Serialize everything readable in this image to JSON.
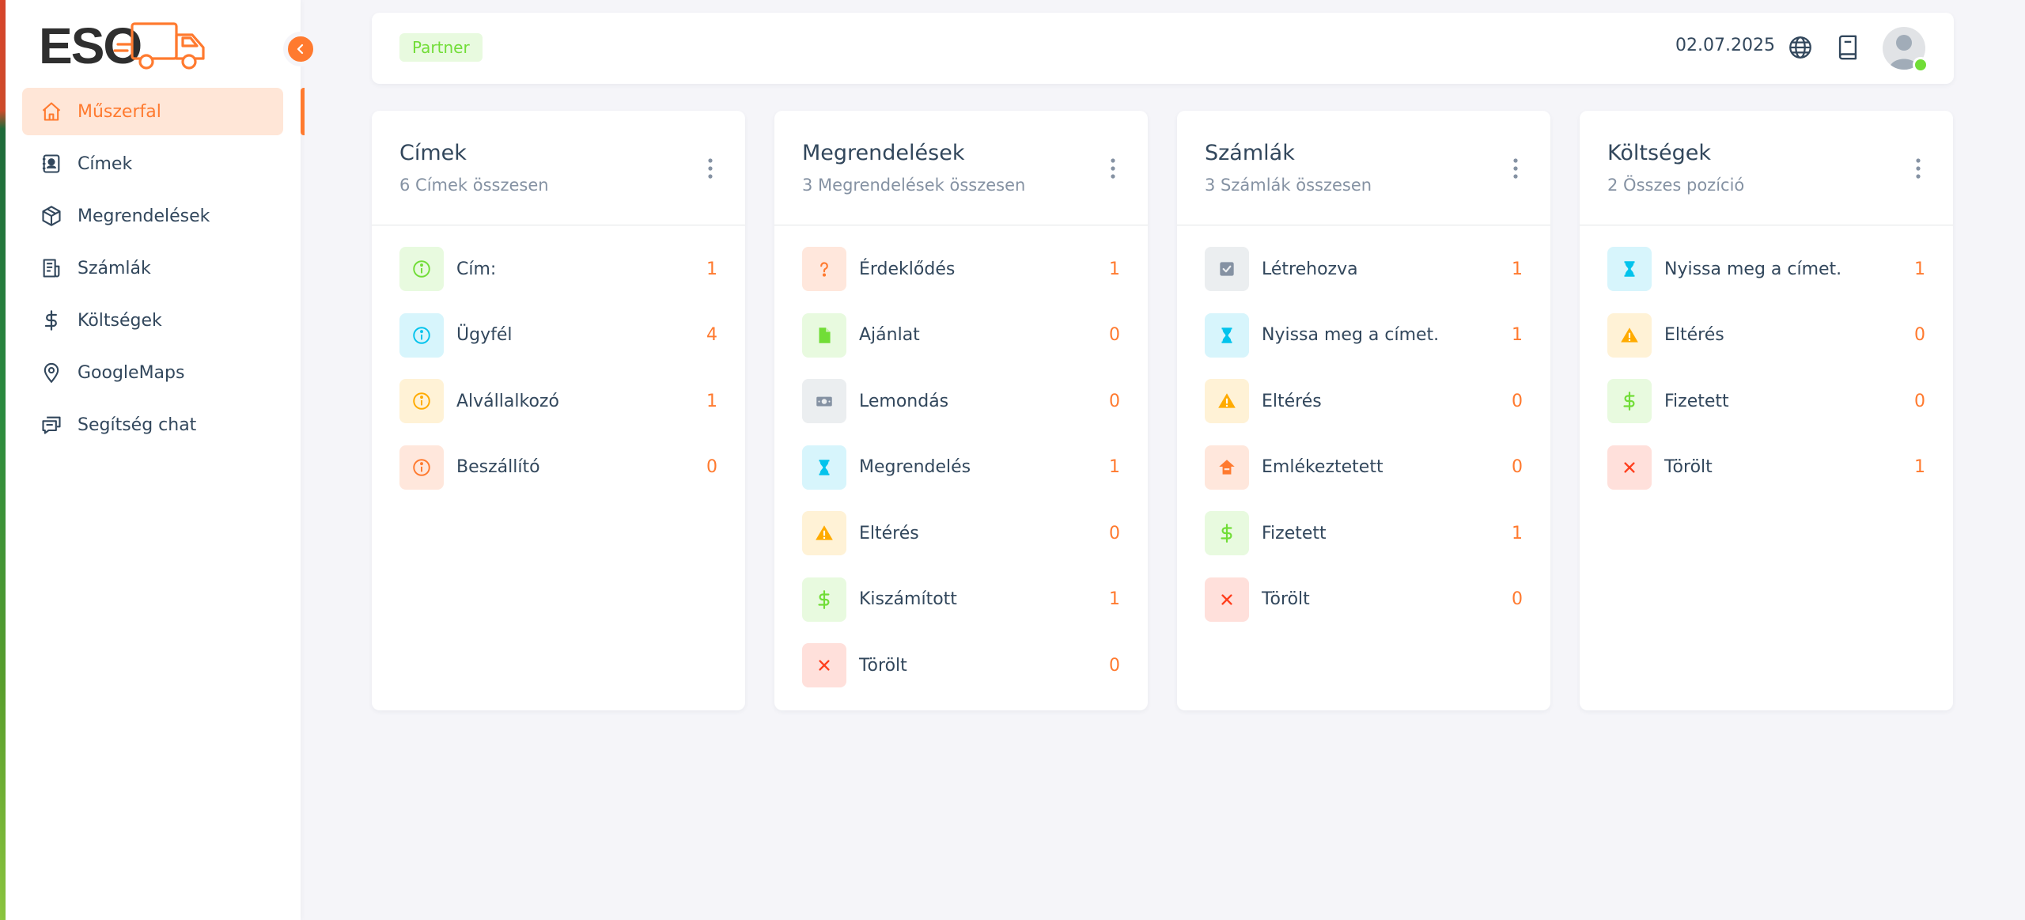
{
  "brand": {
    "logo_text": "ESO"
  },
  "sidebar": {
    "items": [
      {
        "label": "Műszerfal",
        "icon": "home-icon"
      },
      {
        "label": "Címek",
        "icon": "contact-book-icon"
      },
      {
        "label": "Megrendelések",
        "icon": "package-icon"
      },
      {
        "label": "Számlák",
        "icon": "invoice-icon"
      },
      {
        "label": "Költségek",
        "icon": "dollar-icon"
      },
      {
        "label": "GoogleMaps",
        "icon": "map-pin-icon"
      },
      {
        "label": "Segítség chat",
        "icon": "chat-icon"
      }
    ]
  },
  "header": {
    "badge": "Partner",
    "date": "02.07.2025",
    "icons": [
      "globe-icon",
      "book-icon",
      "avatar"
    ]
  },
  "colors": {
    "accent": "#ff7a2f",
    "success": "#71dd37",
    "info": "#03c3ec",
    "warning": "#ffab00",
    "danger": "#ff3e1d",
    "secondary": "#8592a3"
  },
  "cards": [
    {
      "title": "Címek",
      "subtitle": "6 Címek összesen",
      "rows": [
        {
          "label": "Cím:",
          "count": "1",
          "icon": "info-circle-icon"
        },
        {
          "label": "Ügyfél",
          "count": "4",
          "icon": "info-circle-icon"
        },
        {
          "label": "Alvállalkozó",
          "count": "1",
          "icon": "info-circle-icon"
        },
        {
          "label": "Beszállító",
          "count": "0",
          "icon": "info-circle-icon"
        }
      ]
    },
    {
      "title": "Megrendelések",
      "subtitle": "3 Megrendelések összesen",
      "rows": [
        {
          "label": "Érdeklődés",
          "count": "1",
          "icon": "question-icon"
        },
        {
          "label": "Ajánlat",
          "count": "0",
          "icon": "file-icon"
        },
        {
          "label": "Lemondás",
          "count": "0",
          "icon": "money-icon"
        },
        {
          "label": "Megrendelés",
          "count": "1",
          "icon": "hourglass-icon"
        },
        {
          "label": "Eltérés",
          "count": "0",
          "icon": "warning-icon"
        },
        {
          "label": "Kiszámított",
          "count": "1",
          "icon": "dollar-icon"
        },
        {
          "label": "Törölt",
          "count": "0",
          "icon": "close-icon"
        }
      ]
    },
    {
      "title": "Számlák",
      "subtitle": "3 Számlák összesen",
      "rows": [
        {
          "label": "Létrehozva",
          "count": "1",
          "icon": "checkbox-icon"
        },
        {
          "label": "Nyissa meg a címet.",
          "count": "1",
          "icon": "hourglass-icon"
        },
        {
          "label": "Eltérés",
          "count": "0",
          "icon": "warning-icon"
        },
        {
          "label": "Emlékeztetett",
          "count": "0",
          "icon": "reminder-icon"
        },
        {
          "label": "Fizetett",
          "count": "1",
          "icon": "dollar-icon"
        },
        {
          "label": "Törölt",
          "count": "0",
          "icon": "close-icon"
        }
      ]
    },
    {
      "title": "Költségek",
      "subtitle": "2 Összes pozíció",
      "rows": [
        {
          "label": "Nyissa meg a címet.",
          "count": "1",
          "icon": "hourglass-icon"
        },
        {
          "label": "Eltérés",
          "count": "0",
          "icon": "warning-icon"
        },
        {
          "label": "Fizetett",
          "count": "0",
          "icon": "dollar-icon"
        },
        {
          "label": "Törölt",
          "count": "1",
          "icon": "close-icon"
        }
      ]
    }
  ]
}
